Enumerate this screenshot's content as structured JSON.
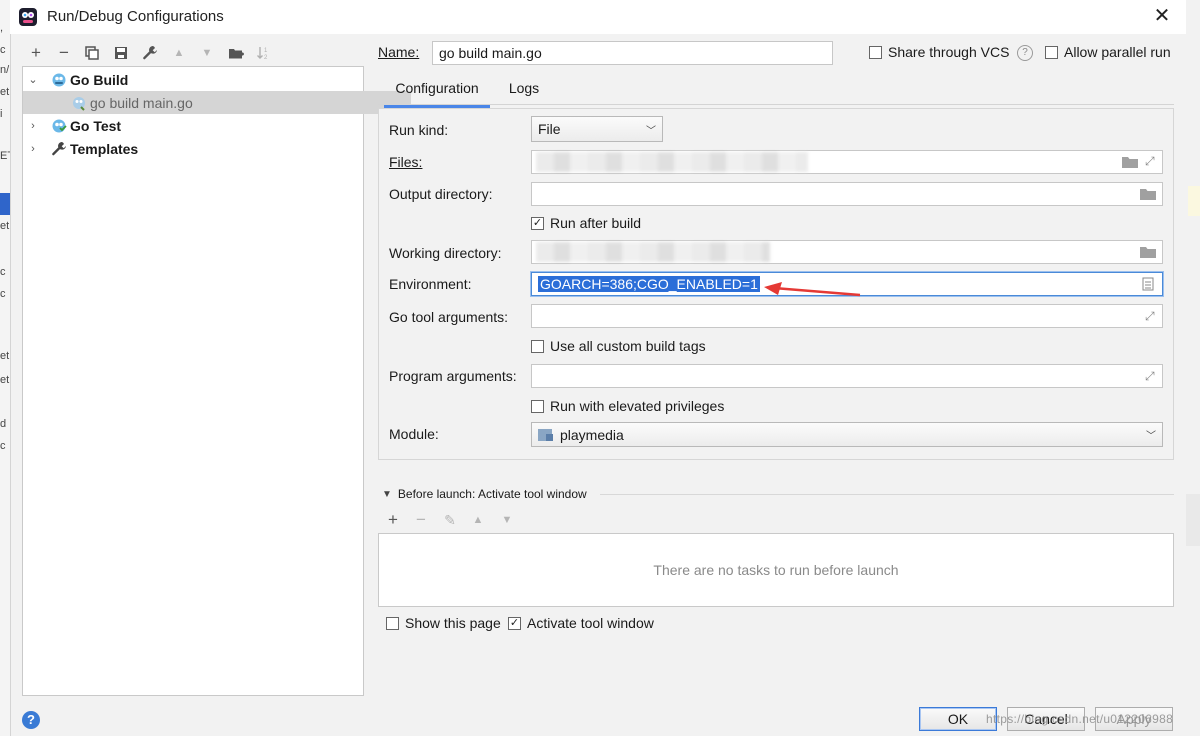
{
  "window": {
    "title": "Run/Debug Configurations",
    "close_glyph": "✕"
  },
  "toolbar": {
    "buttons": [
      {
        "name": "add-button",
        "glyph": "+",
        "enabled": true
      },
      {
        "name": "remove-button",
        "glyph": "−",
        "enabled": true
      },
      {
        "name": "copy-button",
        "glyph": "⧉",
        "enabled": true
      },
      {
        "name": "save-button",
        "glyph": "💾",
        "enabled": true
      },
      {
        "name": "edit-defaults-button",
        "glyph": "🔧",
        "enabled": true
      },
      {
        "name": "move-up-button",
        "glyph": "▲",
        "enabled": false
      },
      {
        "name": "move-down-button",
        "glyph": "▼",
        "enabled": false
      },
      {
        "name": "new-folder-button",
        "glyph": "📁",
        "enabled": true
      },
      {
        "name": "sort-button",
        "glyph": "↓",
        "enabled": false
      }
    ]
  },
  "tree": {
    "items": [
      {
        "label": "Go Build",
        "bold": true,
        "expanded": true,
        "icon": "go-build-icon"
      },
      {
        "label": "go build main.go",
        "bold": false,
        "selected": true,
        "icon": "go-file-icon"
      },
      {
        "label": "Go Test",
        "bold": true,
        "expanded": false,
        "icon": "go-test-icon"
      },
      {
        "label": "Templates",
        "bold": true,
        "expanded": false,
        "icon": "wrench-icon"
      }
    ],
    "chev_open": "⌄",
    "chev_closed": "›"
  },
  "header": {
    "name_label": "Name:",
    "name_value": "go build main.go",
    "share_vcs_label": "Share through VCS",
    "share_vcs_checked": false,
    "help_glyph": "?",
    "allow_parallel_label": "Allow parallel run",
    "allow_parallel_checked": false
  },
  "tabs": [
    {
      "label": "Configuration",
      "active": true
    },
    {
      "label": "Logs",
      "active": false
    }
  ],
  "config": {
    "run_kind_label": "Run kind:",
    "run_kind_value": "File",
    "files_label": "Files:",
    "output_dir_label": "Output directory:",
    "output_dir_value": "",
    "run_after_build_label": "Run after build",
    "run_after_build_checked": true,
    "working_dir_label": "Working directory:",
    "environment_label": "Environment:",
    "environment_value": "GOARCH=386;CGO_ENABLED=1",
    "go_tool_args_label": "Go tool arguments:",
    "go_tool_args_value": "",
    "custom_build_tags_label": "Use all custom build tags",
    "custom_build_tags_checked": false,
    "program_args_label": "Program arguments:",
    "program_args_value": "",
    "elevated_label": "Run with elevated privileges",
    "elevated_checked": false,
    "module_label": "Module:",
    "module_value": "playmedia"
  },
  "before_launch": {
    "title": "Before launch: Activate tool window",
    "toolbar": [
      {
        "name": "add-task-button",
        "glyph": "+",
        "enabled": true
      },
      {
        "name": "remove-task-button",
        "glyph": "−",
        "enabled": false
      },
      {
        "name": "edit-task-button",
        "glyph": "✎",
        "enabled": false
      },
      {
        "name": "task-up-button",
        "glyph": "▲",
        "enabled": false
      },
      {
        "name": "task-down-button",
        "glyph": "▼",
        "enabled": false
      }
    ],
    "empty_text": "There are no tasks to run before launch",
    "show_page_label": "Show this page",
    "show_page_checked": false,
    "activate_window_label": "Activate tool window",
    "activate_window_checked": true
  },
  "footer": {
    "ok_label": "OK",
    "cancel_label": "Cancel",
    "apply_label": "Apply",
    "help_glyph": "?",
    "watermark": "https://blog.csdn.net/u012206988"
  },
  "colors": {
    "accent": "#4a86e8",
    "selection": "#2b6ed8",
    "annotation_arrow": "#e53935"
  },
  "bleed_text": {
    "fragments": [
      ",",
      "c",
      "n/",
      "et",
      "i",
      "ET",
      "_E",
      "et",
      "c",
      "c",
      "et",
      "et",
      "d",
      "c"
    ]
  }
}
